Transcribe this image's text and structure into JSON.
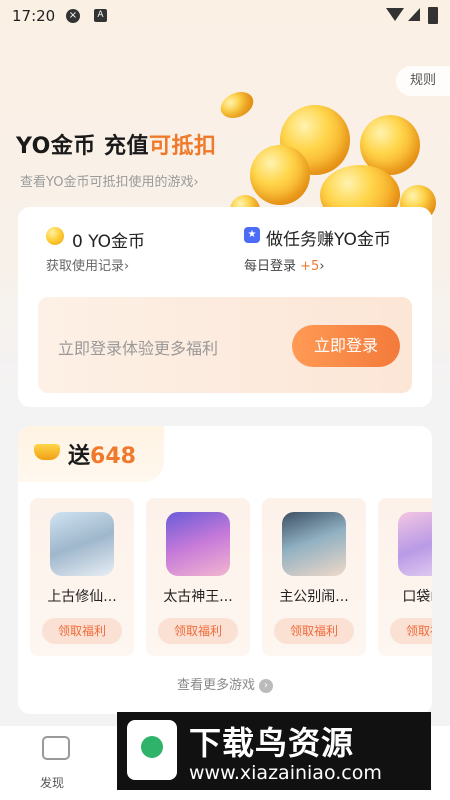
{
  "status_bar": {
    "time": "17:20",
    "icon_x": "x-circle-icon",
    "icon_a": "a-square-icon"
  },
  "header": {
    "rules_label": "规则",
    "title_main": "YO金币 充值",
    "title_highlight": "可抵扣",
    "subtitle": "查看YO金币可抵扣使用的游戏",
    "subtitle_arrow": "›"
  },
  "wallet": {
    "balance": "0 YO金币",
    "records_link": "获取使用记录",
    "records_arrow": "›",
    "task_title": "做任务赚YO金币",
    "daily_login": "每日登录",
    "daily_bonus": "+5",
    "daily_arrow": "›",
    "login_prompt": "立即登录体验更多福利",
    "login_button": "立即登录"
  },
  "gift": {
    "label": "送",
    "amount": "648",
    "games": [
      {
        "name": "上古修仙...",
        "claim": "领取福利"
      },
      {
        "name": "太古神王...",
        "claim": "领取福利"
      },
      {
        "name": "主公别闹...",
        "claim": "领取福利"
      },
      {
        "name": "口袋山...",
        "claim": "领取福利"
      }
    ],
    "more_games": "查看更多游戏"
  },
  "nav": {
    "discover_label": "发现"
  },
  "watermark": {
    "title": "下载鸟资源",
    "url": "www.xiazainiao.com"
  },
  "colors": {
    "accent": "#f07a2b",
    "login_button": "#f37a3a",
    "coin": "#ffcf3a"
  }
}
